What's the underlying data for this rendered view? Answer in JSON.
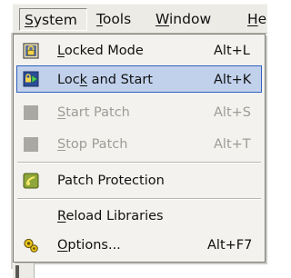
{
  "menubar": {
    "items": [
      {
        "label": "System",
        "mnemonic": "S",
        "active": true
      },
      {
        "label": "Tools",
        "mnemonic": "T"
      },
      {
        "label": "Window",
        "mnemonic": "W"
      },
      {
        "label": "Help",
        "mnemonic": "H"
      }
    ]
  },
  "menu": {
    "items": [
      {
        "pre": "",
        "mn": "L",
        "post": "ocked Mode",
        "shortcut": "Alt+L",
        "icon": "lock-icon",
        "state": "normal"
      },
      {
        "pre": "Loc",
        "mn": "k",
        "post": " and Start",
        "shortcut": "Alt+K",
        "icon": "lock-and-start-icon",
        "state": "highlighted"
      },
      {
        "pre": "",
        "mn": "S",
        "post": "tart Patch",
        "shortcut": "Alt+S",
        "icon": "start-patch-icon",
        "state": "disabled"
      },
      {
        "pre": "",
        "mn": "S",
        "post": "top Patch",
        "shortcut": "Alt+T",
        "icon": "stop-patch-icon",
        "state": "disabled"
      },
      {
        "pre": "Patch Protection",
        "mn": "",
        "post": "",
        "shortcut": "",
        "icon": "patch-protection-icon",
        "state": "normal"
      },
      {
        "pre": "",
        "mn": "R",
        "post": "eload Libraries",
        "shortcut": "",
        "icon": "",
        "state": "normal"
      },
      {
        "pre": "",
        "mn": "O",
        "post": "ptions...",
        "shortcut": "Alt+F7",
        "icon": "options-gears-icon",
        "state": "normal"
      }
    ]
  },
  "colors": {
    "menu_bg": "#f3f2ee",
    "highlight_bg": "#c1d1ec",
    "highlight_border": "#3161c1",
    "disabled_text": "#9d9c97"
  }
}
